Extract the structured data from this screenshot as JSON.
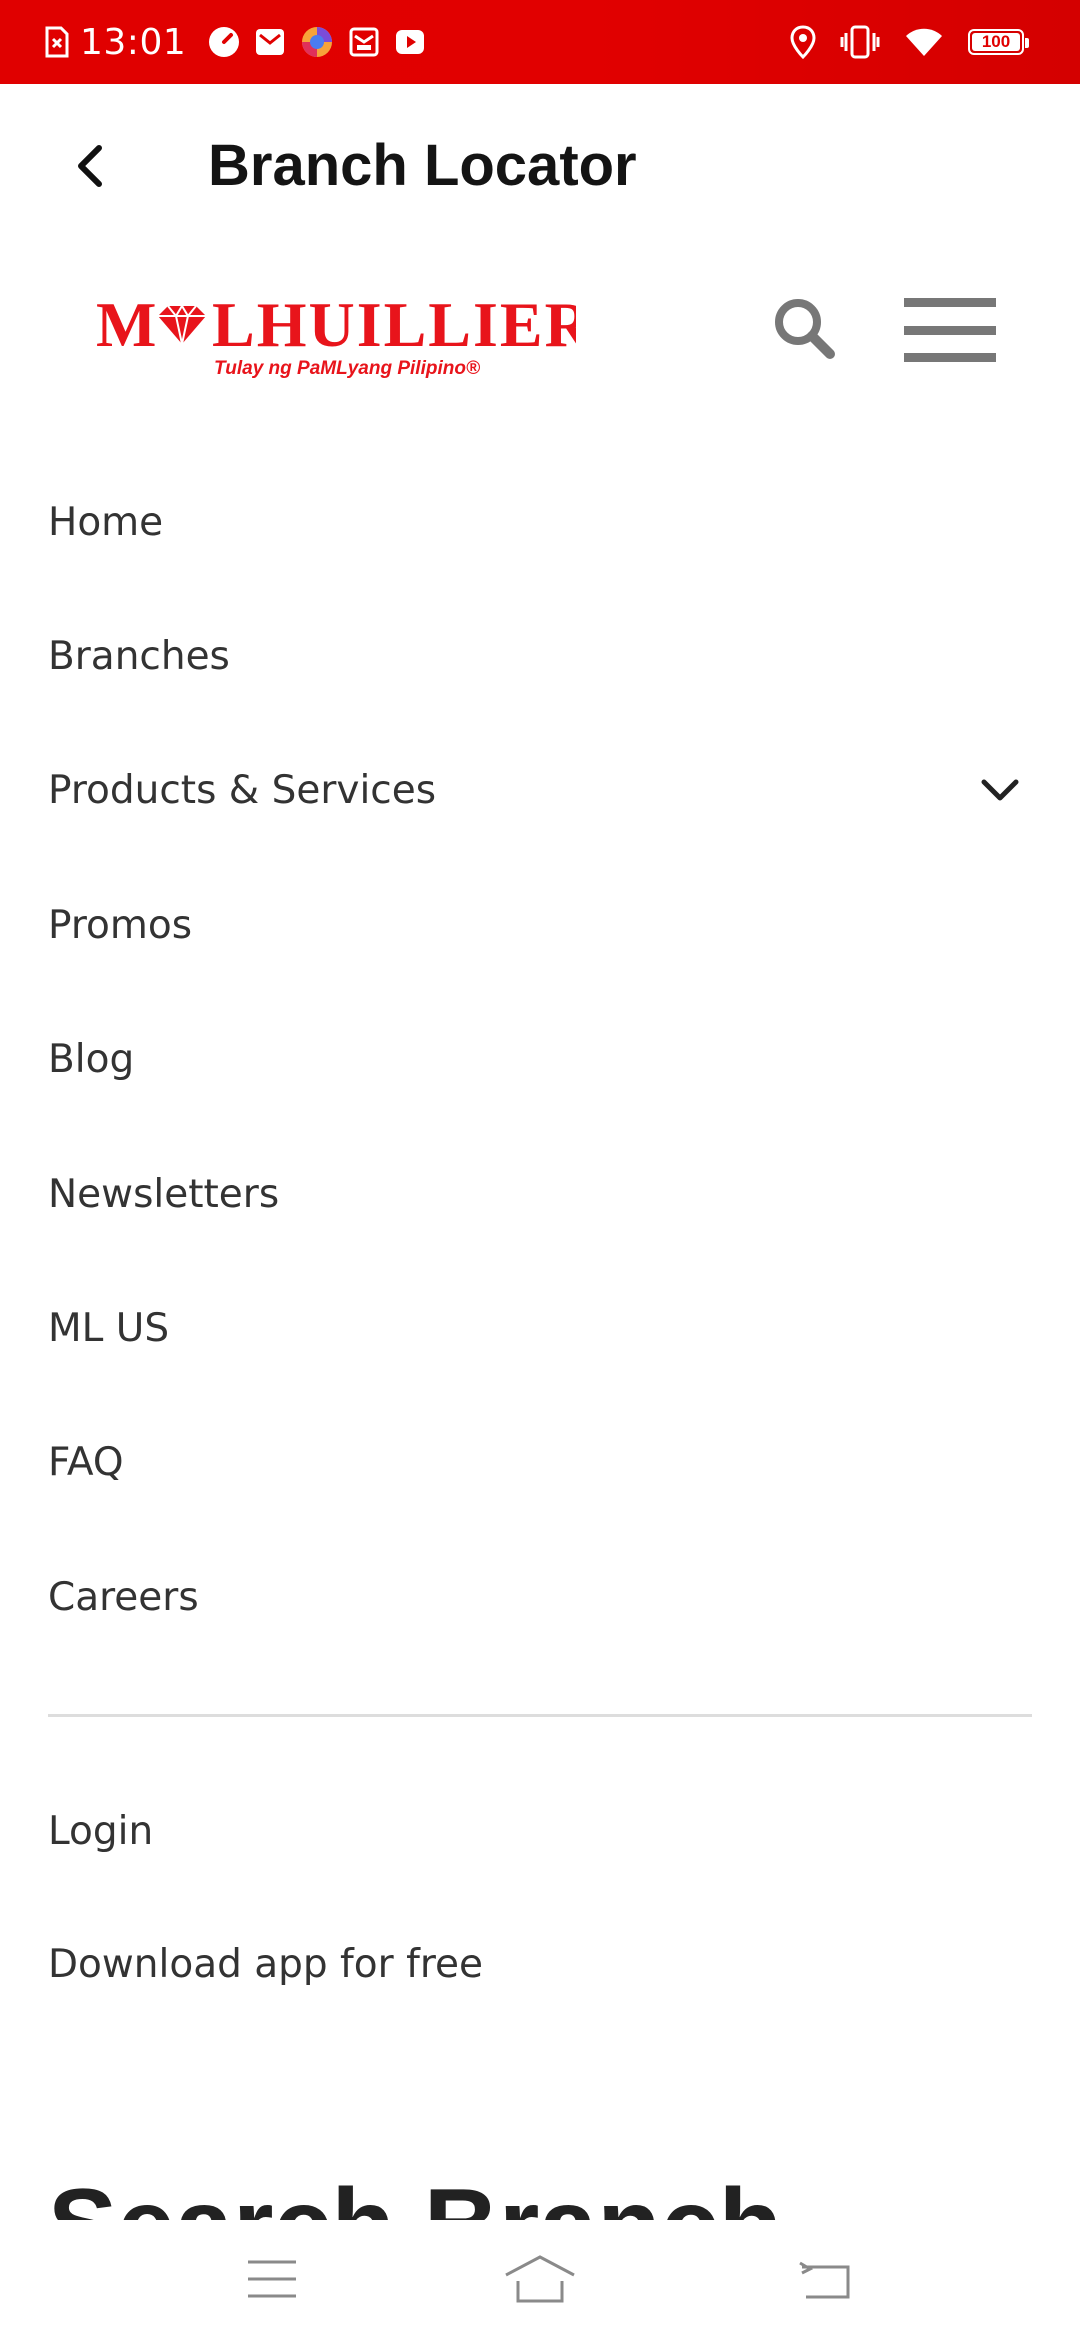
{
  "status_bar": {
    "time": "13:01",
    "battery": "100",
    "left_icons": [
      "sim-error-icon",
      "speedometer-icon",
      "mail-icon",
      "browser-icon",
      "inbox-icon",
      "youtube-icon"
    ],
    "right_icons": [
      "location-icon",
      "vibrate-icon",
      "wifi-icon",
      "battery-icon"
    ]
  },
  "app_bar": {
    "title": "Branch Locator",
    "back_icon": "back-arrow-icon"
  },
  "site_header": {
    "logo_text": "MLHUILLIER",
    "logo_tagline": "Tulay ng PaMLyang Pilipino",
    "search_icon": "search-icon",
    "menu_icon": "hamburger-icon"
  },
  "nav_menu": {
    "items": [
      {
        "label": "Home"
      },
      {
        "label": "Branches"
      },
      {
        "label": "Products & Services",
        "expandable": true
      },
      {
        "label": "Promos"
      },
      {
        "label": "Blog"
      },
      {
        "label": "Newsletters"
      },
      {
        "label": "ML US"
      },
      {
        "label": "FAQ"
      },
      {
        "label": "Careers"
      }
    ],
    "secondary_items": [
      {
        "label": "Login"
      },
      {
        "label": "Download app for free"
      }
    ]
  },
  "main": {
    "heading_partial": "Search Branch"
  },
  "system_nav": {
    "buttons": [
      "recents-icon",
      "home-icon",
      "back-icon"
    ]
  },
  "colors": {
    "brand_red": "#E8141B",
    "status_bar": "#E00000",
    "text": "#333333",
    "icon_gray": "#777777"
  }
}
